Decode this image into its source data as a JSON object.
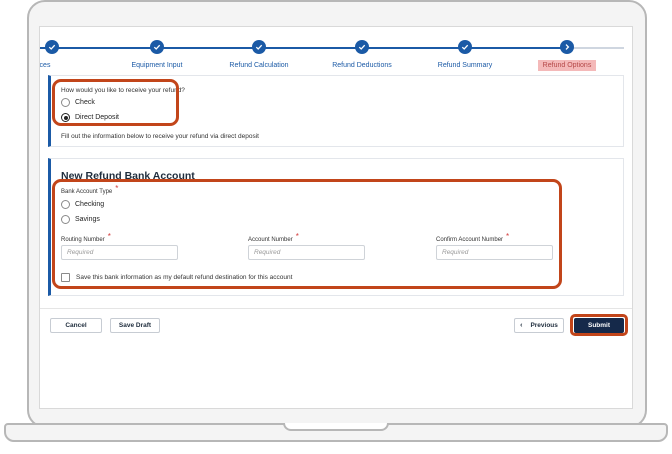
{
  "stepper": {
    "steps": [
      {
        "label": "Devices",
        "state": "done"
      },
      {
        "label": "Equipment Input",
        "state": "done"
      },
      {
        "label": "Refund Calculation",
        "state": "done"
      },
      {
        "label": "Refund Deductions",
        "state": "done"
      },
      {
        "label": "Refund Summary",
        "state": "done"
      },
      {
        "label": "Refund Options",
        "state": "active"
      }
    ]
  },
  "refund_method": {
    "question": "How would you like to receive your refund?",
    "options": [
      "Check",
      "Direct Deposit"
    ],
    "selected": "Direct Deposit",
    "info": "Fill out the information below to receive your refund via direct deposit"
  },
  "bank_account": {
    "title": "New Refund Bank Account",
    "type_label": "Bank Account Type",
    "type_options": [
      "Checking",
      "Savings"
    ],
    "required_mark": "*",
    "routing_label": "Routing Number",
    "account_label": "Account Number",
    "confirm_label": "Confirm Account Number",
    "placeholder": "Required",
    "save_default_label": "Save this bank information as my default refund destination for this account"
  },
  "actions": {
    "cancel": "Cancel",
    "save_draft": "Save Draft",
    "previous": "Previous",
    "submit": "Submit"
  },
  "colors": {
    "accent": "#1b5aa6",
    "highlight": "#c2451a",
    "primary_button": "#15294a",
    "active_step": "#f4b9b9"
  }
}
